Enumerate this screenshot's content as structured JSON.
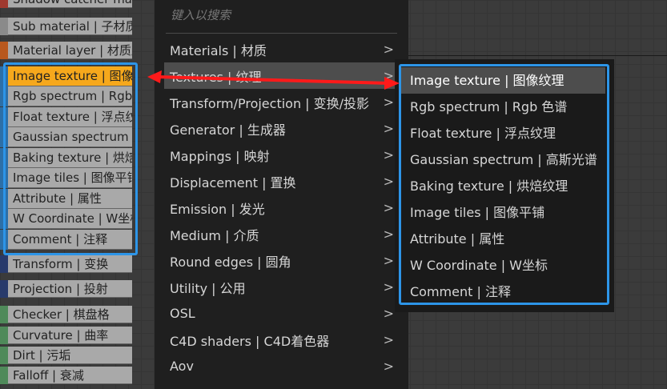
{
  "nodes": [
    {
      "label": "Shadow catcher mat",
      "color": "#a0392f"
    },
    {
      "label": "Sub material | 子材质",
      "color": "#8a8a8a"
    },
    {
      "label": "Material layer | 材质层",
      "color": "#b8581e"
    },
    {
      "label": "Image texture | 图像纹理",
      "color": "#2c6fa8"
    },
    {
      "label": "Rgb spectrum | Rgb 色谱",
      "color": "#2c6fa8"
    },
    {
      "label": "Float texture | 浮点纹理",
      "color": "#2c6fa8"
    },
    {
      "label": "Gaussian spectrum | 高斯光谱",
      "color": "#2c6fa8"
    },
    {
      "label": "Baking texture | 烘焙纹理",
      "color": "#2c6fa8"
    },
    {
      "label": "Image tiles | 图像平铺",
      "color": "#2c6fa8"
    },
    {
      "label": "Attribute | 属性",
      "color": "#2c6fa8"
    },
    {
      "label": "W Coordinate | W坐标",
      "color": "#2c6fa8"
    },
    {
      "label": "Comment | 注释",
      "color": "#2c6fa8"
    },
    {
      "label": "Transform | 变换",
      "color": "#283a6b"
    },
    {
      "label": "Projection | 投射",
      "color": "#283a6b"
    },
    {
      "label": "Checker | 棋盘格",
      "color": "#4f8a5a"
    },
    {
      "label": "Curvature | 曲率",
      "color": "#4f8a5a"
    },
    {
      "label": "Dirt | 污垢",
      "color": "#4f8a5a"
    },
    {
      "label": "Falloff | 衰减",
      "color": "#4f8a5a"
    }
  ],
  "menu": {
    "search_placeholder": "键入以搜索",
    "items": [
      "Materials | 材质",
      "Textures | 纹理",
      "Transform/Projection | 变换/投影",
      "Generator | 生成器",
      "Mappings | 映射",
      "Displacement | 置换",
      "Emission | 发光",
      "Medium | 介质",
      "Round edges | 圆角",
      "Utility | 公用",
      "OSL",
      "C4D shaders | C4D着色器",
      "Aov"
    ],
    "chevron": ">"
  },
  "submenu": {
    "items": [
      "Image texture | 图像纹理",
      "Rgb spectrum | Rgb 色谱",
      "Float texture | 浮点纹理",
      "Gaussian spectrum | 高斯光谱",
      "Baking texture | 烘焙纹理",
      "Image tiles | 图像平铺",
      "Attribute | 属性",
      "W Coordinate | W坐标",
      "Comment | 注释"
    ]
  },
  "colors": {
    "highlight": "#f6a81c",
    "accent": "#2d95e8",
    "arrow": "#ff1a1a"
  }
}
